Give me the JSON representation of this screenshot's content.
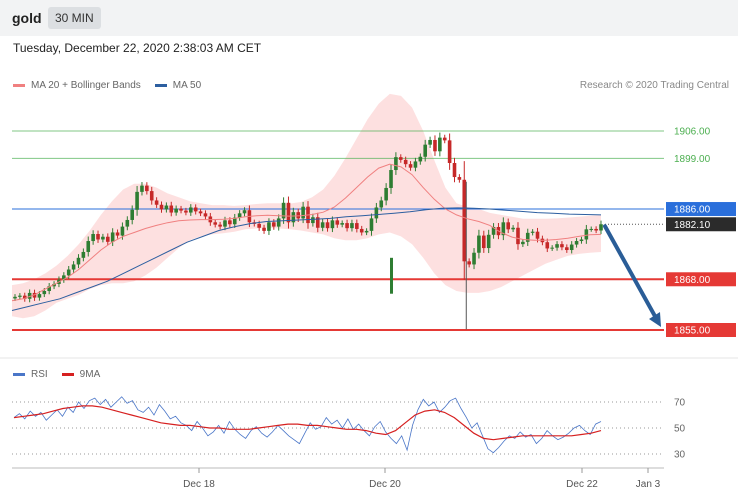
{
  "header": {
    "symbol": "gold",
    "timeframe": "30 MIN",
    "datetime": "Tuesday, December 22, 2020 2:38:03 AM CET",
    "copyright": "Research © 2020 Trading Central"
  },
  "legend": {
    "main": [
      {
        "label": "MA 20 + Bollinger Bands",
        "color": "#f08080"
      },
      {
        "label": "MA 50",
        "color": "#2d5fa0"
      }
    ],
    "rsi": [
      {
        "label": "RSI",
        "color": "#4a76c8"
      },
      {
        "label": "9MA",
        "color": "#d62020"
      }
    ]
  },
  "chart_data": [
    {
      "type": "candlestick",
      "title": "gold 30 MIN",
      "x_ticks": [
        "Dec 18",
        "Dec 20",
        "Dec 22",
        "Jan 3"
      ],
      "ylim": [
        1850,
        1922
      ],
      "price_levels": [
        {
          "label": "1906.00",
          "value": 1906.0,
          "kind": "resistance",
          "color": "#4caf50"
        },
        {
          "label": "1899.00",
          "value": 1899.0,
          "kind": "resistance",
          "color": "#4caf50"
        },
        {
          "label": "1886.00",
          "value": 1886.0,
          "kind": "pivot",
          "color": "#2a6fdb"
        },
        {
          "label": "1868.00",
          "value": 1868.0,
          "kind": "support",
          "color": "#e53935"
        },
        {
          "label": "1855.00",
          "value": 1855.0,
          "kind": "support",
          "color": "#e53935"
        }
      ],
      "last_price": {
        "label": "1882.10",
        "value": 1882.1
      },
      "close_series": [
        1863.5,
        1863.8,
        1863.0,
        1864.5,
        1863.3,
        1864.2,
        1865.0,
        1866.2,
        1866.8,
        1867.9,
        1869.0,
        1870.5,
        1871.8,
        1873.5,
        1875.0,
        1877.8,
        1879.6,
        1878.2,
        1878.9,
        1877.6,
        1880.0,
        1879.2,
        1881.5,
        1883.2,
        1885.8,
        1890.4,
        1892.0,
        1890.6,
        1888.2,
        1887.1,
        1885.9,
        1886.9,
        1885.1,
        1886.1,
        1885.6,
        1885.1,
        1886.4,
        1885.4,
        1884.9,
        1884.1,
        1882.6,
        1882.0,
        1881.5,
        1883.1,
        1882.1,
        1883.8,
        1884.9,
        1885.7,
        1882.6,
        1882.2,
        1881.2,
        1880.4,
        1882.6,
        1881.5,
        1883.6,
        1887.6,
        1882.6,
        1885.2,
        1883.6,
        1886.6,
        1882.4,
        1883.9,
        1881.2,
        1882.6,
        1881.1,
        1883.1,
        1882.0,
        1882.4,
        1881.1,
        1882.4,
        1880.9,
        1880.0,
        1880.4,
        1883.6,
        1886.4,
        1888.2,
        1891.4,
        1896.0,
        1899.3,
        1898.6,
        1897.5,
        1896.6,
        1898.2,
        1899.4,
        1902.5,
        1903.7,
        1900.8,
        1904.3,
        1903.6,
        1897.8,
        1894.2,
        1893.5,
        1872.6,
        1871.8,
        1874.8,
        1879.2,
        1876.0,
        1879.4,
        1881.4,
        1879.3,
        1882.6,
        1880.8,
        1881.2,
        1877.0,
        1877.6,
        1879.9,
        1880.2,
        1878.4,
        1877.5,
        1875.9,
        1876.1,
        1877.0,
        1876.2,
        1875.5,
        1876.9,
        1877.8,
        1878.2,
        1880.8,
        1880.9,
        1880.5,
        1882.1
      ],
      "ma20_series": [
        1862.5,
        1863.0,
        1864.0,
        1865.5,
        1867.0,
        1868.5,
        1870.5,
        1873.0,
        1875.5,
        1877.5,
        1879.0,
        1880.0,
        1881.0,
        1881.8,
        1882.5,
        1883.0,
        1883.2,
        1883.3,
        1883.3,
        1883.4,
        1883.6,
        1884.0,
        1884.3,
        1884.4,
        1884.3,
        1884.2,
        1884.3,
        1884.6,
        1885.2,
        1886.5,
        1888.8,
        1891.5,
        1894.2,
        1896.5,
        1897.5,
        1896.8,
        1894.8,
        1891.5,
        1888.5,
        1886.0,
        1884.5,
        1883.5,
        1882.8,
        1881.8,
        1880.0,
        1878.8,
        1878.2,
        1878.0,
        1878.0,
        1878.2,
        1878.5,
        1879.0,
        1879.4,
        1879.5
      ],
      "ma50_series": [
        1860.0,
        1861.0,
        1862.0,
        1863.0,
        1864.5,
        1866.0,
        1867.5,
        1869.5,
        1871.5,
        1873.5,
        1875.5,
        1877.5,
        1879.0,
        1880.5,
        1881.5,
        1882.3,
        1882.8,
        1883.0,
        1883.2,
        1883.4,
        1883.6,
        1884.0,
        1884.3,
        1884.6,
        1884.9,
        1885.3,
        1885.8,
        1886.2,
        1886.3,
        1886.2,
        1886.0,
        1885.7,
        1885.4,
        1885.1,
        1884.9,
        1884.7,
        1884.6,
        1884.5
      ],
      "bands_upper": [
        1866.5,
        1867.0,
        1868.0,
        1869.5,
        1871.5,
        1874.0,
        1877.0,
        1880.5,
        1884.5,
        1888.0,
        1891.0,
        1892.5,
        1892.5,
        1891.5,
        1890.0,
        1889.0,
        1888.0,
        1887.5,
        1887.0,
        1887.0,
        1886.8,
        1887.0,
        1887.3,
        1887.5,
        1887.5,
        1887.4,
        1887.8,
        1889.0,
        1891.0,
        1894.5,
        1899.0,
        1904.0,
        1909.0,
        1913.0,
        1915.5,
        1915.0,
        1912.0,
        1906.0,
        1898.5,
        1891.5,
        1887.5,
        1886.5,
        1886.0,
        1885.0,
        1884.5,
        1884.0,
        1883.5,
        1883.5,
        1883.5,
        1883.6,
        1883.8,
        1884.0,
        1884.3,
        1884.5
      ],
      "bands_lower": [
        1858.5,
        1858.0,
        1858.5,
        1860.0,
        1862.0,
        1863.0,
        1864.0,
        1865.5,
        1866.5,
        1867.0,
        1867.0,
        1867.5,
        1869.0,
        1871.0,
        1873.5,
        1876.0,
        1878.0,
        1879.0,
        1879.5,
        1879.8,
        1880.2,
        1880.8,
        1881.0,
        1881.2,
        1881.0,
        1880.8,
        1880.5,
        1880.0,
        1879.5,
        1878.5,
        1878.0,
        1878.0,
        1878.5,
        1879.5,
        1880.0,
        1879.0,
        1877.0,
        1873.5,
        1869.5,
        1866.5,
        1865.0,
        1864.5,
        1864.5,
        1865.0,
        1866.0,
        1867.5,
        1869.0,
        1870.5,
        1872.0,
        1873.0,
        1874.0,
        1874.5,
        1874.8,
        1875.0
      ],
      "forecast_arrow": {
        "from": 1882.1,
        "to": 1855.0
      },
      "bollinger_bands": true,
      "grid": false
    },
    {
      "type": "line",
      "title": "RSI",
      "ylim": [
        20,
        80
      ],
      "y_ticks": [
        "70",
        "50",
        "30"
      ],
      "y_tick_values": [
        70,
        50,
        30
      ],
      "series": [
        {
          "name": "RSI",
          "color": "#4a76c8",
          "values": [
            58,
            61,
            57,
            63,
            59,
            62,
            56,
            60,
            64,
            59,
            66,
            62,
            70,
            65,
            71,
            73,
            68,
            72,
            66,
            70,
            74,
            69,
            71,
            64,
            62,
            66,
            60,
            68,
            63,
            57,
            59,
            54,
            52,
            48,
            55,
            50,
            44,
            47,
            52,
            46,
            55,
            49,
            45,
            42,
            48,
            51,
            46,
            43,
            47,
            52,
            48,
            44,
            41,
            38,
            46,
            54,
            49,
            51,
            58,
            53,
            56,
            50,
            57,
            49,
            53,
            48,
            44,
            51,
            55,
            47,
            42,
            38,
            44,
            33,
            52,
            64,
            72,
            67,
            70,
            62,
            66,
            71,
            73,
            65,
            58,
            50,
            54,
            44,
            34,
            31,
            35,
            40,
            44,
            42,
            47,
            43,
            45,
            38,
            42,
            48,
            44,
            41,
            43,
            46,
            50,
            52,
            48,
            45,
            53,
            55
          ]
        },
        {
          "name": "9MA",
          "color": "#d62020",
          "values": [
            58,
            59,
            60,
            61,
            63,
            65,
            66,
            67,
            67,
            66,
            64,
            62,
            60,
            58,
            56,
            54,
            53,
            52,
            52,
            51,
            50,
            50,
            49,
            49,
            49,
            50,
            51,
            52,
            53,
            53,
            52,
            52,
            51,
            50,
            49,
            49,
            48,
            46,
            45,
            48,
            54,
            60,
            63,
            64,
            62,
            58,
            52,
            46,
            42,
            41,
            42,
            43,
            44,
            44,
            44,
            44,
            44,
            44,
            45,
            46,
            48
          ]
        }
      ]
    }
  ]
}
